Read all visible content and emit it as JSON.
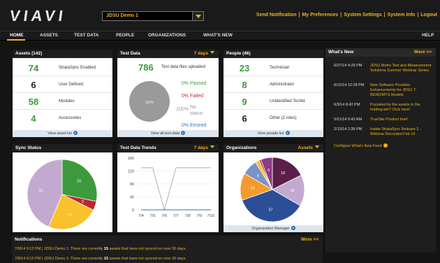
{
  "app": {
    "logo": "VIAVI"
  },
  "org_select": {
    "value": "JDSU Demo 1"
  },
  "top_links": [
    "Send Notification",
    "My Preferences",
    "System Settings",
    "System Info",
    "Logout"
  ],
  "nav": {
    "items": [
      "HOME",
      "ASSETS",
      "TEST DATA",
      "PEOPLE",
      "ORGANIZATIONS",
      "WHAT'S NEW"
    ],
    "help": "HELP"
  },
  "assets": {
    "title": "Assets (142)",
    "rows": [
      {
        "num": "74",
        "label": "StrataSync Enabled"
      },
      {
        "num": "6",
        "label": "User Defined"
      },
      {
        "num": "58",
        "label": "Modules"
      },
      {
        "num": "4",
        "label": "Accessories"
      }
    ],
    "footer": "View asset list"
  },
  "test_data": {
    "title": "Test Data",
    "range": "7 days",
    "count": "786",
    "count_label": "Test data files uploaded",
    "pie_label": "100%",
    "stats": [
      {
        "pct": "0%",
        "label": "Passed"
      },
      {
        "pct": "0%",
        "label": "Failed"
      },
      {
        "pct": "100%",
        "label": "No status"
      },
      {
        "pct": "0%",
        "label": "Errored"
      }
    ],
    "footer": "View all test data"
  },
  "people": {
    "title": "People (46)",
    "rows": [
      {
        "num": "23",
        "label": "Technician"
      },
      {
        "num": "8",
        "label": "Administrator"
      },
      {
        "num": "9",
        "label": "Unidentified Techld"
      },
      {
        "num": "6",
        "label": "Other (2 roles)"
      }
    ],
    "footer": "View people list"
  },
  "sync_status": {
    "title": "Sync Status",
    "chart_data": {
      "type": "pie",
      "labels": [
        "20",
        "3",
        "17",
        "31"
      ],
      "values": [
        20,
        3,
        17,
        31
      ],
      "colors": [
        "#3c9a3c",
        "#c0262b",
        "#f9c12b",
        "#c3a9cf"
      ]
    }
  },
  "trends": {
    "title": "Test Data Trends",
    "range": "7 days",
    "chart_data": {
      "type": "line",
      "categories": [
        "7/4",
        "7/5",
        "7/6",
        "7/7",
        "7/8",
        "7/9",
        "7/10"
      ],
      "series": [
        {
          "values": [
            130,
            130,
            0,
            130,
            130,
            130,
            130
          ],
          "color": "#aaaaaa"
        },
        {
          "values": [
            0,
            0,
            0,
            0,
            0,
            0,
            0
          ],
          "color": "#2e73b8"
        }
      ],
      "yticks": [
        0,
        40,
        80,
        120,
        160
      ],
      "ylim": [
        0,
        160
      ]
    }
  },
  "organizations": {
    "title": "Organizations",
    "selector": "Assets",
    "chart_data": {
      "type": "pie",
      "labels": [
        "18",
        "16",
        "37",
        "14",
        "8",
        "",
        "",
        "6"
      ],
      "values": [
        18,
        16,
        37,
        14,
        8,
        2,
        1,
        6
      ],
      "colors": [
        "#5b1e4a",
        "#c3a9cf",
        "#2b4f96",
        "#f39a2f",
        "#7a93c4",
        "#f9c12b",
        "#c0262b",
        "#8a3c86"
      ]
    },
    "footer": "Organization Manager"
  },
  "whats_new": {
    "title": "What's New",
    "more": "More >>",
    "items": [
      {
        "date": "6/27/14 4:29 PM",
        "text": "JDSU Metro Test and Measurement Solutions Summer Webinar Series"
      },
      {
        "date": "6/12/14 12:28 PM",
        "text": "New Software Provides Enhancements for JDSU T-BERD/MTS Models"
      },
      {
        "date": "6/3/14 8:42 PM",
        "text": "Puzzeled by the assets in the holding bin? Click here!"
      },
      {
        "date": "5/21/14 9:43 AM",
        "text": "TrueSite Product brief"
      },
      {
        "date": "2/13/14 2:39 PM",
        "text": "Inside StrataSync Release 2 - Webinar Recorded Feb 19"
      }
    ],
    "configure": "Configure What's New Feed"
  },
  "notifications": {
    "title": "Notifications",
    "more": "More >>",
    "items": [
      {
        "time": "7/8/14 9:12 PM",
        "org": "JDSU Demo 1",
        "prefix": ": There are currently",
        "count": "15",
        "suffix": "assets that have not synced on over 30 days."
      },
      {
        "time": "7/8/14 9:12 PM",
        "org": "JDSU Demo 1",
        "prefix": ": There are currently",
        "count": "15",
        "suffix": "assets that have not synced on over 30 days."
      }
    ]
  }
}
